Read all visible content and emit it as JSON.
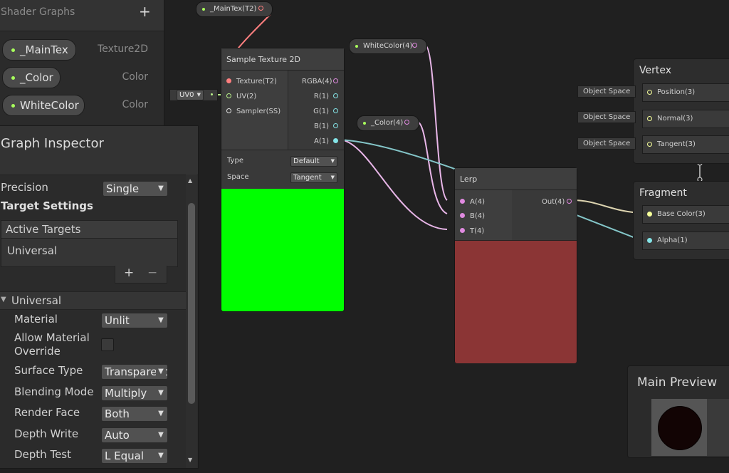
{
  "blackboard": {
    "title": "Shader Graphs",
    "add_label": "+",
    "properties": [
      {
        "name": "_MainTex",
        "type": "Texture2D"
      },
      {
        "name": "_Color",
        "type": "Color"
      },
      {
        "name": "WhiteColor",
        "type": "Color"
      }
    ]
  },
  "inspector": {
    "title": "Graph Inspector",
    "precision_label": "Precision",
    "precision_value": "Single",
    "target_settings": "Target Settings",
    "active_targets": "Active Targets",
    "target_item": "Universal",
    "plus": "+",
    "minus": "−",
    "universal_header": "Universal",
    "fields": [
      {
        "label": "Material",
        "value": "Unlit"
      },
      {
        "label": "Allow Material Override",
        "value": ""
      },
      {
        "label": "Surface Type",
        "value": "Transparent"
      },
      {
        "label": "Blending Mode",
        "value": "Multiply"
      },
      {
        "label": "Render Face",
        "value": "Both"
      },
      {
        "label": "Depth Write",
        "value": "Auto"
      },
      {
        "label": "Depth Test",
        "value": "L Equal"
      }
    ]
  },
  "nodes": {
    "maintex_chip": "_MainTex(T2)",
    "whitecolor_chip": "WhiteColor(4)",
    "color_chip": "_Color(4)",
    "uv_dropdown": "UV0",
    "sample_texture": {
      "title": "Sample Texture 2D",
      "inputs": [
        "Texture(T2)",
        "UV(2)",
        "Sampler(SS)"
      ],
      "outputs": [
        "RGBA(4)",
        "R(1)",
        "G(1)",
        "B(1)",
        "A(1)"
      ],
      "type_label": "Type",
      "type_value": "Default",
      "space_label": "Space",
      "space_value": "Tangent",
      "preview_color": "#00ff00"
    },
    "lerp": {
      "title": "Lerp",
      "inputs": [
        "A(4)",
        "B(4)",
        "T(4)"
      ],
      "output": "Out(4)",
      "preview_color": "#8b3535"
    }
  },
  "master": {
    "vertex_title": "Vertex",
    "vertex_slots": [
      {
        "tag": "Object Space",
        "label": "Position(3)"
      },
      {
        "tag": "Object Space",
        "label": "Normal(3)"
      },
      {
        "tag": "Object Space",
        "label": "Tangent(3)"
      }
    ],
    "fragment_title": "Fragment",
    "fragment_slots": [
      "Base Color(3)",
      "Alpha(1)"
    ]
  },
  "preview": {
    "title": "Main Preview"
  },
  "colors": {
    "texture_port": "#ff7f7f",
    "vector4_port": "#e08ae0",
    "vector2_port": "#b8f08a",
    "vector1_port": "#84e4e7",
    "vector3_port": "#f6ff9a",
    "accent_green": "#a8ff5c"
  }
}
